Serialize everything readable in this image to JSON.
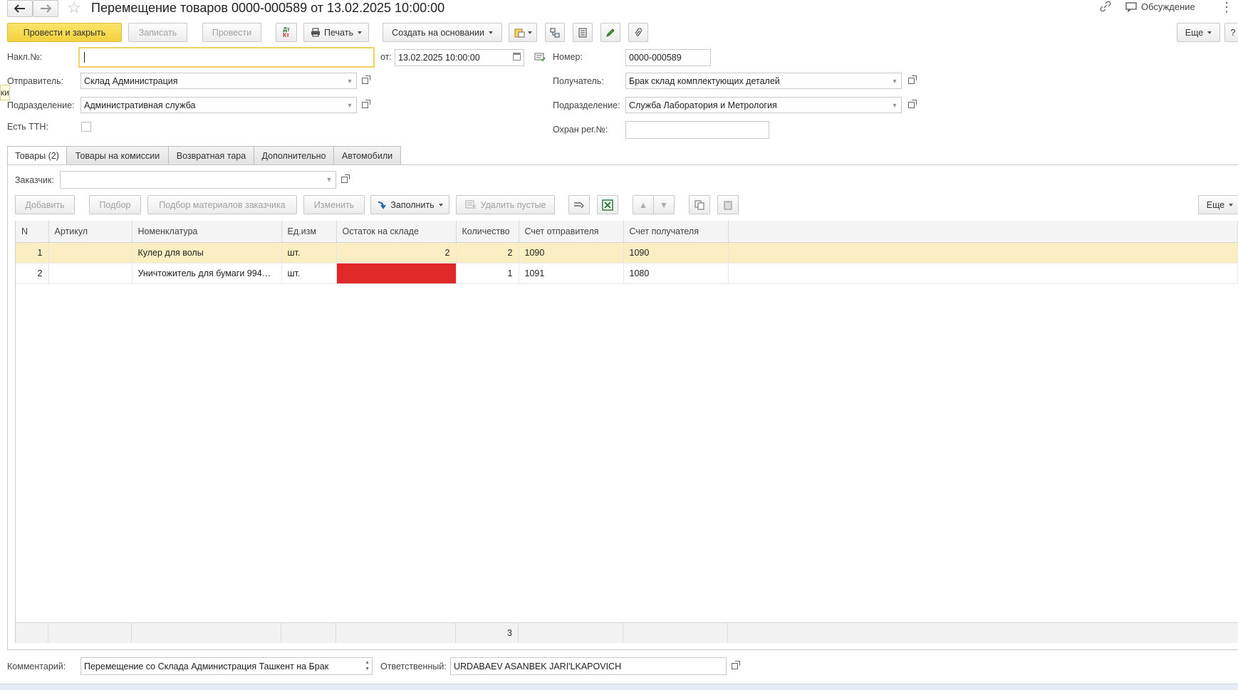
{
  "window": {
    "title": "Перемещение товаров 0000-000589 от 13.02.2025 10:00:00",
    "discussion_label": "Обсуждение"
  },
  "toolbar": {
    "post_close": "Провести и закрыть",
    "save": "Записать",
    "post": "Провести",
    "print": "Печать",
    "create_based": "Создать на основании",
    "more": "Еще",
    "help": "?"
  },
  "form": {
    "invoice_label": "Накл.№:",
    "invoice_value": "",
    "from_label": "от:",
    "date_value": "13.02.2025 10:00:00",
    "number_label": "Номер:",
    "number_value": "0000-000589",
    "sender_label": "Отправитель:",
    "sender_value": "Склад Администрация",
    "receiver_label": "Получатель:",
    "receiver_value": "Брак склад комплектующих деталей",
    "dept_label": "Подразделение:",
    "sender_dept_value": "Административная служба",
    "receiver_dept_value": "Служба Лаборатория и Метрология",
    "ttn_label": "Есть ТТН:",
    "guard_label": "Охран рег.№:",
    "guard_value": "",
    "side_tip": "ки"
  },
  "tabs": [
    "Товары (2)",
    "Товары на комиссии",
    "Возвратная тара",
    "Дополнительно",
    "Автомобили"
  ],
  "goods": {
    "customer_label": "Заказчик:",
    "customer_value": "",
    "add": "Добавить",
    "pick": "Подбор",
    "pick_customer": "Подбор материалов заказчика",
    "edit": "Изменить",
    "fill": "Заполнить",
    "delete_empty": "Удалить пустые",
    "more": "Еще",
    "columns": [
      "N",
      "Артикул",
      "Номенклатура",
      "Ед.изм",
      "Остаток на складе",
      "Количество",
      "Счет отправителя",
      "Счет получателя"
    ],
    "rows": [
      {
        "n": "1",
        "article": "",
        "name": "Кулер для волы",
        "unit": "шт.",
        "stock": "2",
        "qty": "2",
        "acc_from": "1090",
        "acc_to": "1090"
      },
      {
        "n": "2",
        "article": "",
        "name": "Уничтожитель для бумаги 994…",
        "unit": "шт.",
        "stock": "",
        "qty": "1",
        "acc_from": "1091",
        "acc_to": "1080"
      }
    ],
    "total_qty": "3",
    "stock_alert_color": "#e02828"
  },
  "footer": {
    "comment_label": "Комментарий:",
    "comment_value": "Перемещение со Склада Администрация Ташкент на Брак",
    "responsible_label": "Ответственный:",
    "responsible_value": "URDABAEV ASANBEK JARI'LKAPOVICH"
  }
}
